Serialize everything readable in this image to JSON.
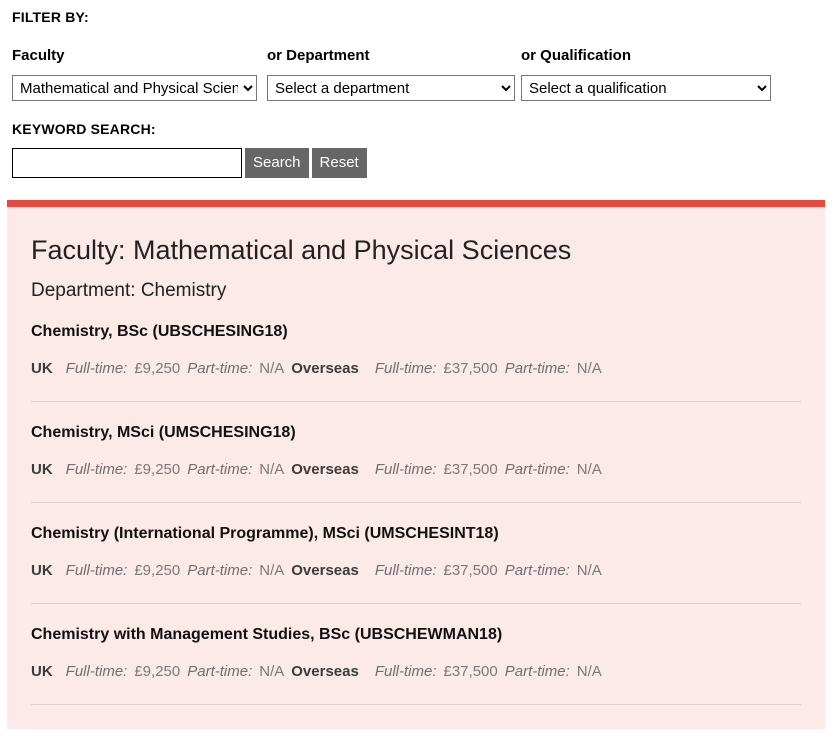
{
  "filter": {
    "heading": "FILTER BY:",
    "columns": [
      {
        "label": "Faculty",
        "selected": "Mathematical and Physical Sciences"
      },
      {
        "label": "or Department",
        "selected": "Select a department"
      },
      {
        "label": "or Qualification",
        "selected": "Select a qualification"
      }
    ],
    "keyword_heading": "KEYWORD SEARCH:",
    "keyword_value": "",
    "keyword_placeholder": "",
    "search_label": "Search",
    "reset_label": "Reset"
  },
  "results": {
    "faculty_title": "Faculty: Mathematical and Physical Sciences",
    "department_title": "Department: Chemistry",
    "fee_terms": {
      "uk_label": "UK",
      "overseas_label": "Overseas",
      "full_time_label": "Full-time:",
      "part_time_label": "Part-time:"
    },
    "courses": [
      {
        "name": "Chemistry, BSc (UBSCHESING18)",
        "uk_full_time": "£9,250",
        "uk_part_time": "N/A",
        "overseas_full_time": "£37,500",
        "overseas_part_time": "N/A"
      },
      {
        "name": "Chemistry, MSci (UMSCHESING18)",
        "uk_full_time": "£9,250",
        "uk_part_time": "N/A",
        "overseas_full_time": "£37,500",
        "overseas_part_time": "N/A"
      },
      {
        "name": "Chemistry (International Programme), MSci (UMSCHESINT18)",
        "uk_full_time": "£9,250",
        "uk_part_time": "N/A",
        "overseas_full_time": "£37,500",
        "overseas_part_time": "N/A"
      },
      {
        "name": "Chemistry with Management Studies, BSc (UBSCHEWMAN18)",
        "uk_full_time": "£9,250",
        "uk_part_time": "N/A",
        "overseas_full_time": "£37,500",
        "overseas_part_time": "N/A"
      }
    ]
  },
  "colors": {
    "accent_bar": "#e8493f",
    "panel_background": "#fbeae8",
    "button_background": "#666666",
    "separator": "#e0cfcd"
  }
}
